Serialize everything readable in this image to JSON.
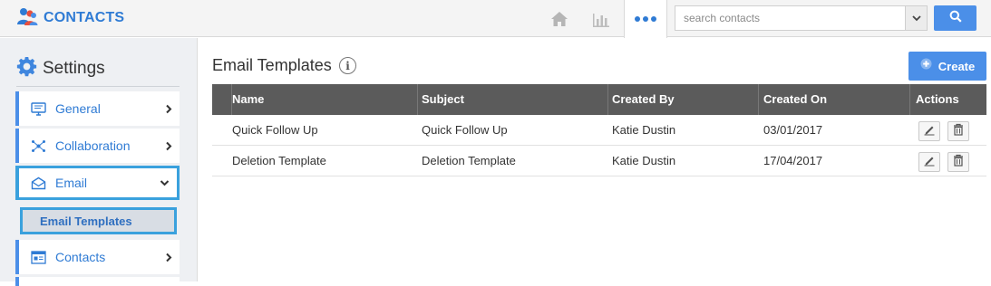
{
  "app": {
    "title": "CONTACTS"
  },
  "topbar": {
    "icons": [
      "contacts-logo-icon",
      "home-icon",
      "bar-chart-icon",
      "more-dots-icon",
      "chevron-down-icon",
      "search-icon"
    ]
  },
  "search": {
    "placeholder": "search contacts",
    "value": ""
  },
  "sidebar": {
    "title": "Settings",
    "items": [
      {
        "label": "General",
        "icon": "monitor-icon",
        "chevron": "chevron-right-icon"
      },
      {
        "label": "Collaboration",
        "icon": "network-icon",
        "chevron": "chevron-right-icon"
      },
      {
        "label": "Email",
        "icon": "envelope-icon",
        "chevron": "chevron-down-icon",
        "active": true
      },
      {
        "label": "Contacts",
        "icon": "contact-card-icon",
        "chevron": "chevron-right-icon"
      }
    ],
    "sub_item": {
      "label": "Email Templates"
    }
  },
  "main": {
    "title": "Email Templates",
    "create_label": "Create",
    "columns": [
      "Name",
      "Subject",
      "Created By",
      "Created On",
      "Actions"
    ],
    "rows": [
      {
        "name": "Quick Follow Up",
        "subject": "Quick Follow Up",
        "created_by": "Katie Dustin",
        "created_on": "03/01/2017"
      },
      {
        "name": "Deletion Template",
        "subject": "Deletion Template",
        "created_by": "Katie Dustin",
        "created_on": "17/04/2017"
      }
    ]
  },
  "colors": {
    "accent": "#4b8fe8",
    "brand": "#2f7bd4",
    "active_border": "#3aa1dd",
    "table_header": "#5b5b5b"
  }
}
